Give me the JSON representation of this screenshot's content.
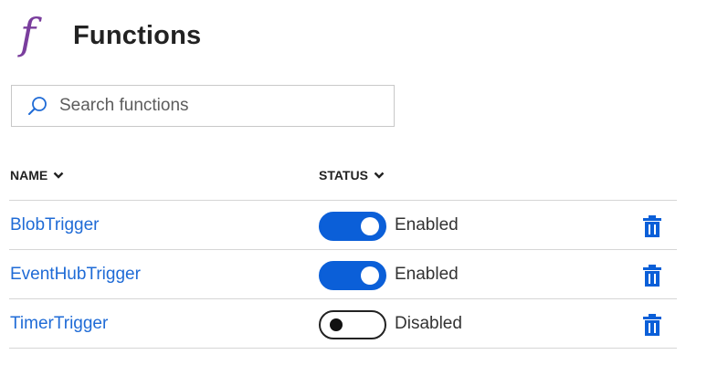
{
  "header": {
    "icon": "function-icon",
    "icon_glyph": "f",
    "title": "Functions"
  },
  "search": {
    "icon": "search-icon",
    "placeholder": "Search functions",
    "value": ""
  },
  "table": {
    "columns": [
      {
        "label": "NAME",
        "icon": "chevron-down-icon"
      },
      {
        "label": "STATUS",
        "icon": "chevron-down-icon"
      }
    ],
    "rows": [
      {
        "name": "BlobTrigger",
        "enabled": true,
        "status": "Enabled",
        "delete_icon": "trash-icon"
      },
      {
        "name": "EventHubTrigger",
        "enabled": true,
        "status": "Enabled",
        "delete_icon": "trash-icon"
      },
      {
        "name": "TimerTrigger",
        "enabled": false,
        "status": "Disabled",
        "delete_icon": "trash-icon"
      }
    ]
  },
  "colors": {
    "accent": "#0b5fd8",
    "link": "#1f6bd6",
    "function_icon": "#7a3e9d"
  }
}
